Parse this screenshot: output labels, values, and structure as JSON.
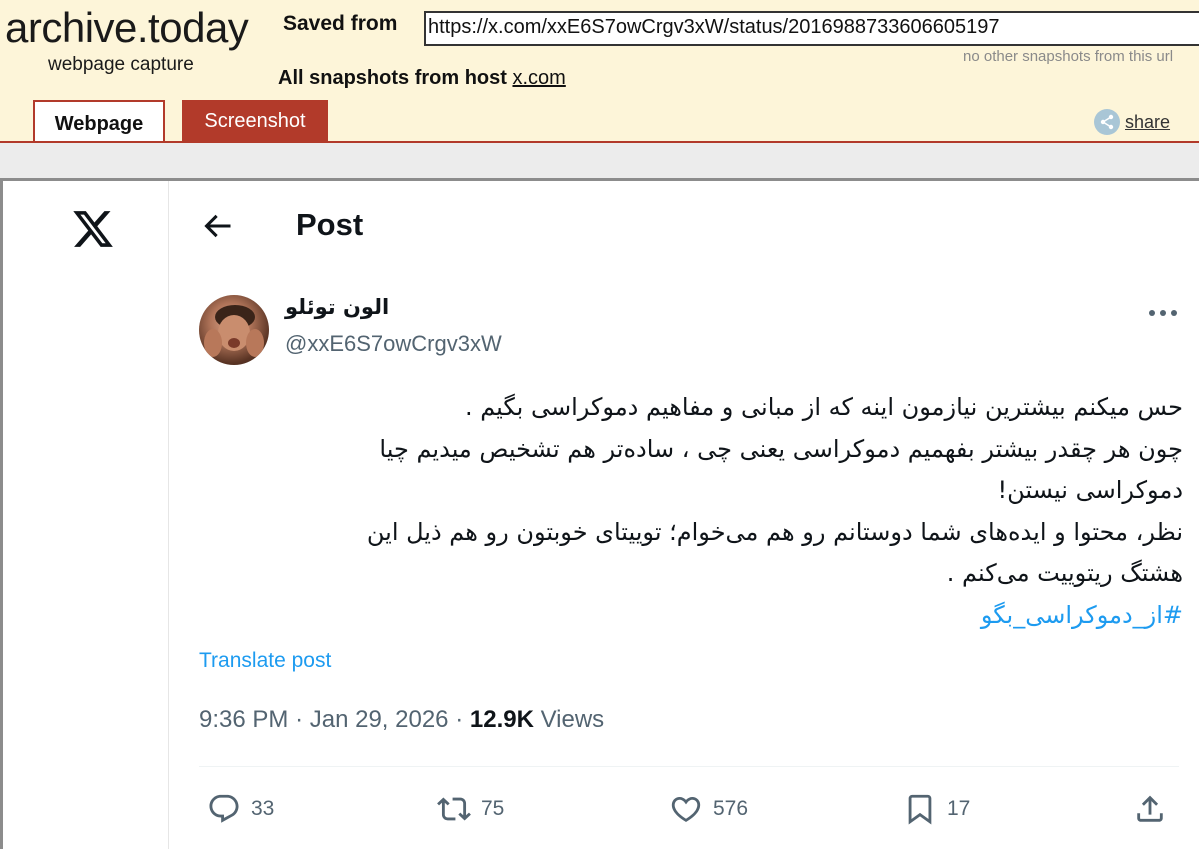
{
  "archive": {
    "logo": "archive.today",
    "subtitle": "webpage capture",
    "saved_from_label": "Saved from",
    "url": "https://x.com/xxE6S7owCrgv3xW/status/2016988733606605197",
    "no_snapshots_text": "no other snapshots from this url",
    "all_snapshots_label": "All snapshots  from host",
    "host_link": "x.com",
    "tabs": {
      "webpage": "Webpage",
      "screenshot": "Screenshot"
    },
    "share_label": "share",
    "accent": "#b23a2a",
    "header_bg": "#fdf5d9"
  },
  "x_page": {
    "header_title": "Post",
    "icons": {
      "logo": "x-logo-icon",
      "back": "arrow-left-icon",
      "more": "more-horizontal-icon"
    },
    "author": {
      "name": "الون توئلو",
      "handle": "@xxE6S7owCrgv3xW"
    },
    "tweet_lines": [
      "حس میکنم بیشترین نیازمون اینه که  از مبانی و مفاهیم دموکراسی بگیم .",
      "چون هر چقدر بیشتر بفهمیم دموکراسی یعنی چی ، ساده‌تر هم  تشخیص میدیم چیا",
      "دموکراسی نیستن!",
      "نظر، محتوا و ایده‌های شما دوستانم رو هم می‌خوام؛ توییتای خوبتون رو هم ذیل این",
      "هشتگ ریتوییت می‌کنم  ."
    ],
    "hashtag": "#از_دموکراسی_بگو",
    "translate_label": "Translate post",
    "meta": {
      "time": "9:36 PM",
      "separator": "·",
      "date": "Jan 29, 2026",
      "views_count": "12.9K",
      "views_label": "Views"
    },
    "actions": {
      "replies": "33",
      "retweets": "75",
      "likes": "576",
      "bookmarks": "17"
    },
    "link_color": "#1d9bf0",
    "secondary_text_color": "#536471"
  }
}
